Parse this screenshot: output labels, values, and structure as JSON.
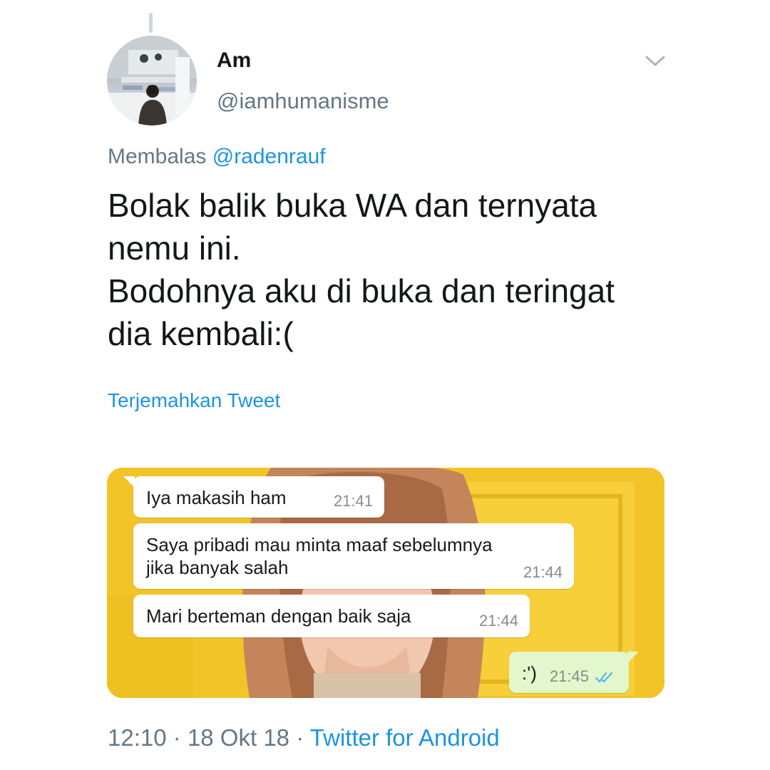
{
  "tweet": {
    "display_name": "Am",
    "handle": "@iamhumanisme",
    "reply_prefix": "Membalas",
    "reply_mention": "@radenrauf",
    "text_lines": [
      "Bolak balik buka WA dan ternyata",
      "nemu ini.",
      "Bodohnya aku di buka dan teringat",
      "dia kembali:("
    ],
    "translate_label": "Terjemahkan Tweet",
    "time": "12:10",
    "separator": "·",
    "date": "18 Okt 18",
    "source": "Twitter for Android"
  },
  "chat": {
    "messages": [
      {
        "direction": "incoming",
        "lines": [
          "Iya makasih ham"
        ],
        "time": "21:41"
      },
      {
        "direction": "incoming",
        "lines": [
          "Saya pribadi mau minta maaf sebelumnya",
          "jika banyak salah"
        ],
        "time": "21:44"
      },
      {
        "direction": "incoming",
        "lines": [
          "Mari berteman dengan baik saja"
        ],
        "time": "21:44"
      },
      {
        "direction": "outgoing",
        "lines": [
          ":')"
        ],
        "time": "21:45",
        "status_icon": "double-check-icon"
      }
    ]
  },
  "icons": {
    "menu": "chevron-down-icon",
    "read_receipt": "double-check-icon"
  },
  "colors": {
    "link_blue": "#1b95e0",
    "secondary_gray": "#657786",
    "text_dark": "#14171a",
    "chat_background_yellow": "#f3c62a",
    "outgoing_bubble": "#e2f7cb",
    "read_tick_blue": "#4fb6ec"
  }
}
